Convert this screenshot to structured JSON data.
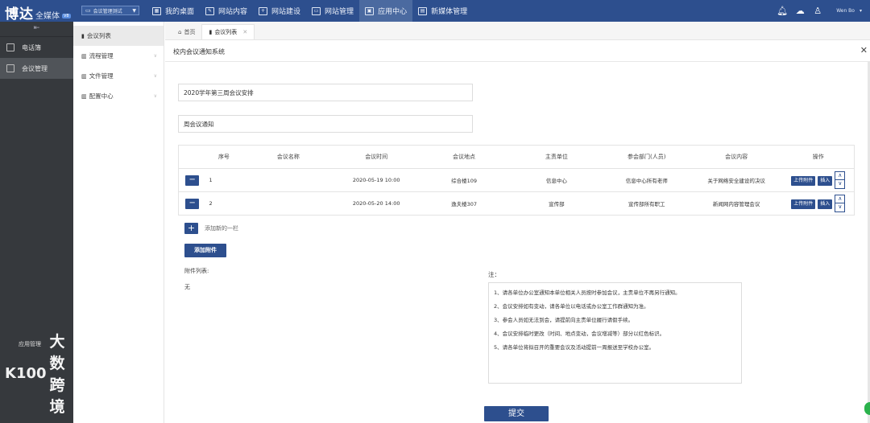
{
  "brand": {
    "name": "博达",
    "sub": "全媒体",
    "badge": "V8"
  },
  "system_select": {
    "icon": "monitor-icon",
    "label": "会议管理测试"
  },
  "nav": [
    {
      "label": "我的桌面",
      "icon": "desktop-icon"
    },
    {
      "label": "网站内容",
      "icon": "edit-icon"
    },
    {
      "label": "网站建设",
      "icon": "build-icon"
    },
    {
      "label": "网站管理",
      "icon": "monitor-icon"
    },
    {
      "label": "应用中心",
      "icon": "app-icon",
      "active": true
    },
    {
      "label": "新媒体管理",
      "icon": "media-icon"
    }
  ],
  "top_icons": [
    "bell-icon",
    "cloud-icon",
    "shirt-icon"
  ],
  "user": {
    "name": "Wen Bo"
  },
  "left_menu": [
    {
      "label": "电话簿",
      "icon": "phonebook-icon"
    },
    {
      "label": "会议管理",
      "icon": "meeting-icon",
      "active": true
    }
  ],
  "watermark": {
    "logo": "K100",
    "text": "大数跨境",
    "small": "应用管理"
  },
  "sub_menu": [
    {
      "label": "会议列表",
      "icon": "bookmark-icon",
      "active": true
    },
    {
      "label": "流程管理",
      "icon": "chart-icon"
    },
    {
      "label": "文件管理",
      "icon": "chart-icon"
    },
    {
      "label": "配置中心",
      "icon": "chart-icon"
    }
  ],
  "tabs": [
    {
      "label": "首页",
      "icon": "home-icon"
    },
    {
      "label": "会议列表",
      "icon": "bookmark-icon",
      "active": true
    }
  ],
  "page": {
    "title": "校内会议通知系统",
    "field1": "2020学年第三周会议安排",
    "field2": "周会议通知"
  },
  "table": {
    "columns": [
      "序号",
      "会议名称",
      "会议时间",
      "会议地点",
      "主责单位",
      "参会部门(人员)",
      "会议内容",
      "操作"
    ],
    "rows": [
      {
        "no": "1",
        "name": "",
        "time": "2020-05-19 10:00",
        "place": "综合楼109",
        "unit": "信息中心",
        "dept": "信息中心所有老师",
        "content": "关于网络安全建设的决议"
      },
      {
        "no": "2",
        "name": "",
        "time": "2020-05-20 14:00",
        "place": "逸夫楼307",
        "unit": "宣传部",
        "dept": "宣传部所有职工",
        "content": "新闻网内容管理会议"
      }
    ],
    "upload_label": "上传附件",
    "insert_label": "插入"
  },
  "add_row_label": "添加新的一栏",
  "attach_button": "添加附件",
  "attach_list_label": "附件列表:",
  "attach_none": "无",
  "note": {
    "label": "注：",
    "lines": [
      "1、请各单位办公室通知本单位相关人员按时参加会议，主责单位不再另行通知。",
      "2、会议安排如有变动，请各单位以电话或办公室工作群通知为准。",
      "3、参会人员如无法到会，请提前向主责单位履行请假手续。",
      "4、会议安排临时更改（时间、地点变动，会议增减等）部分以红色标识。",
      "5、请各单位将拟召开的重要会议及活动提前一周报送至学校办公室。"
    ]
  },
  "submit_label": "提交",
  "colors": {
    "primary": "#2d4f8e",
    "sidebar": "#36393d",
    "fab": "#2bb24c"
  }
}
